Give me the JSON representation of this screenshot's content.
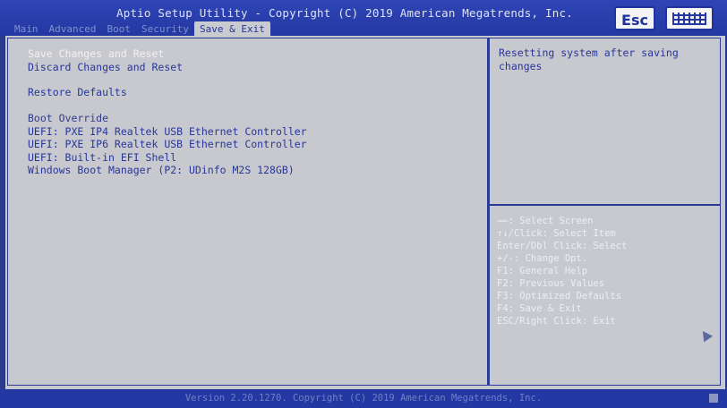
{
  "header": {
    "title": "Aptio Setup Utility - Copyright (C) 2019 American Megatrends, Inc.",
    "tabs": [
      {
        "label": "Main"
      },
      {
        "label": "Advanced"
      },
      {
        "label": "Boot"
      },
      {
        "label": "Security"
      },
      {
        "label": "Save & Exit"
      }
    ],
    "active_tab": "Save & Exit",
    "esc_label": "Esc",
    "keyboard_icon": "keyboard-icon"
  },
  "menu": {
    "items": [
      {
        "label": "Save Changes and Reset"
      },
      {
        "label": "Discard Changes and Reset"
      },
      {
        "label": "Restore Defaults"
      },
      {
        "label": "Boot Override"
      },
      {
        "label": "UEFI: PXE IP4 Realtek USB Ethernet Controller"
      },
      {
        "label": "UEFI: PXE IP6 Realtek USB Ethernet Controller"
      },
      {
        "label": "UEFI: Built-in EFI Shell"
      },
      {
        "label": "Windows Boot Manager (P2: UDinfo M2S 128GB)"
      }
    ],
    "selected": "Save Changes and Reset"
  },
  "help": {
    "description": "Resetting system after saving changes",
    "keys": [
      "→←: Select Screen",
      "↑↓/Click: Select Item",
      "Enter/Dbl Click: Select",
      "+/-: Change Opt.",
      "F1: General Help",
      "F2: Previous Values",
      "F3: Optimized Defaults",
      "F4: Save & Exit",
      "ESC/Right Click: Exit"
    ]
  },
  "footer": {
    "text": "Version 2.20.1270. Copyright (C) 2019 American Megatrends, Inc."
  },
  "colors": {
    "header_bg": "#2438a3",
    "panel_bg": "#c8c9ce",
    "text": "#27369a",
    "highlight": "#f2f2f4"
  }
}
